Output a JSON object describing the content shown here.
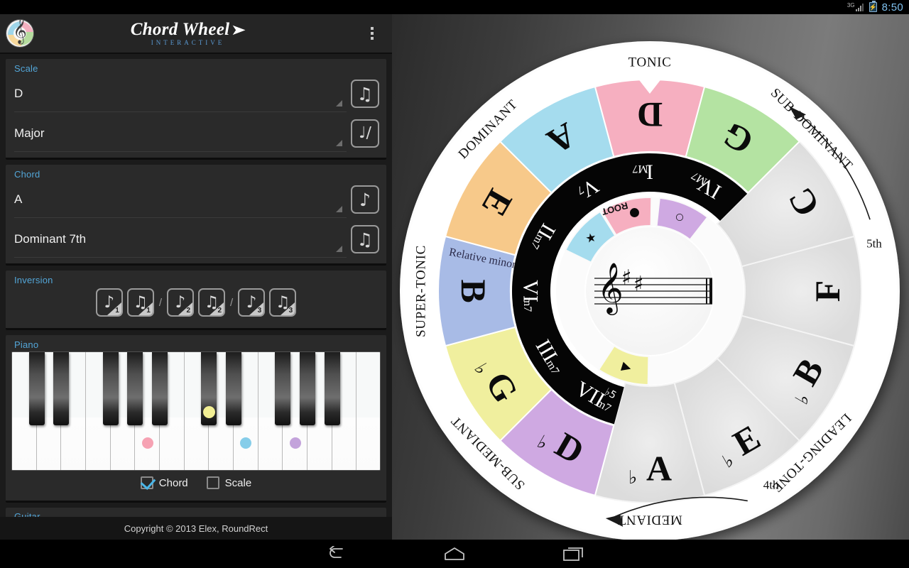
{
  "statusbar": {
    "network": "3G",
    "time": "8:50",
    "battery_icon": "battery-charging-icon"
  },
  "actionbar": {
    "logo_icon": "app-logo-treble-clef-icon",
    "title": "Chord Wheel",
    "wing_icon": "wing-icon",
    "subtitle": "INTERACTIVE",
    "overflow_icon": "overflow-menu-icon"
  },
  "scale_card": {
    "label": "Scale",
    "root": {
      "value": "D",
      "play_icon": "two-eighth-notes-icon"
    },
    "type": {
      "value": "Major",
      "play_icon": "scale-notes-icon"
    }
  },
  "chord_card": {
    "label": "Chord",
    "root": {
      "value": "A",
      "play_icon": "single-note-icon"
    },
    "type": {
      "value": "Dominant 7th",
      "play_icon": "chord-notes-icon"
    }
  },
  "inversion_card": {
    "label": "Inversion",
    "buttons": [
      {
        "icon": "single-note-icon",
        "number": "1"
      },
      {
        "icon": "chord-notes-icon",
        "number": "1"
      },
      {
        "icon": "single-note-icon",
        "number": "2"
      },
      {
        "icon": "chord-notes-icon",
        "number": "2"
      },
      {
        "icon": "single-note-icon",
        "number": "3"
      },
      {
        "icon": "chord-notes-icon",
        "number": "3"
      }
    ],
    "separators": [
      "/",
      "/"
    ]
  },
  "piano_card": {
    "label": "Piano",
    "white_key_count": 15,
    "black_key_count": 10,
    "markers": [
      {
        "note": "A",
        "color": "#f6a2b3",
        "key": "white",
        "index": 5
      },
      {
        "note": "C#",
        "color": "#f2ef94",
        "key": "black",
        "index": 5
      },
      {
        "note": "E",
        "color": "#86cde9",
        "key": "white",
        "index": 9
      },
      {
        "note": "G",
        "color": "#c3a3db",
        "key": "white",
        "index": 11
      }
    ],
    "chord_checkbox": {
      "label": "Chord",
      "checked": true
    },
    "scale_checkbox": {
      "label": "Scale",
      "checked": false
    }
  },
  "guitar_card": {
    "label": "Guitar"
  },
  "footer": {
    "copyright": "Copyright © 2013 Elex, RoundRect"
  },
  "navbar": {
    "back_icon": "back-arrow-icon",
    "home_icon": "home-icon",
    "recents_icon": "recent-apps-icon"
  },
  "wheel": {
    "function_labels": [
      {
        "text": "TONIC",
        "angle": 0
      },
      {
        "text": "SUB-DOMINANT",
        "angle": 45
      },
      {
        "text": "DOMINANT",
        "angle": -45
      },
      {
        "text": "SUPER-TONIC",
        "angle": -90
      },
      {
        "text": "SUB-MEDIANT",
        "angle": -135
      },
      {
        "text": "MEDIANT",
        "angle": 180
      },
      {
        "text": "LEADING-TONE",
        "angle": 135
      }
    ],
    "note_segments": [
      {
        "note": "D",
        "accidental": "",
        "color": "#f6afc0",
        "angle": 0,
        "active": true
      },
      {
        "note": "G",
        "accidental": "",
        "color": "#b4e3a2",
        "angle": 30,
        "active": true
      },
      {
        "note": "C",
        "accidental": "",
        "color": "#e9e9e9",
        "angle": 60,
        "active": false
      },
      {
        "note": "F",
        "accidental": "",
        "color": "#e9e9e9",
        "angle": 90,
        "active": false
      },
      {
        "note": "B",
        "accidental": "♭",
        "color": "#e9e9e9",
        "angle": 120,
        "active": false
      },
      {
        "note": "E",
        "accidental": "♭",
        "color": "#e9e9e9",
        "angle": 150,
        "active": false
      },
      {
        "note": "A",
        "accidental": "♭",
        "color": "#e9e9e9",
        "angle": 180,
        "active": false
      },
      {
        "note": "D",
        "accidental": "♭",
        "color": "#cfa9e2",
        "angle": 210,
        "active": true
      },
      {
        "note": "G",
        "accidental": "♭",
        "color": "#f0ef9e",
        "angle": 240,
        "active": true
      },
      {
        "note": "B",
        "accidental": "",
        "color": "#a8bbe6",
        "angle": 270,
        "active": true
      },
      {
        "note": "E",
        "accidental": "",
        "color": "#f7c98a",
        "angle": 300,
        "active": true
      },
      {
        "note": "A",
        "accidental": "",
        "color": "#a5dcee",
        "angle": 330,
        "active": true
      }
    ],
    "relative_minor_label": "Relative minor",
    "roman_numerals": [
      {
        "numeral": "I",
        "quality": "M7",
        "angle": 0
      },
      {
        "numeral": "IV",
        "quality": "M7",
        "angle": 30
      },
      {
        "numeral": "VII",
        "quality": "m7",
        "flat5": "♭5",
        "angle": 210
      },
      {
        "numeral": "III",
        "quality": "m7",
        "angle": 240
      },
      {
        "numeral": "VI",
        "quality": "m7",
        "angle": 270
      },
      {
        "numeral": "II",
        "quality": "m7",
        "angle": 300
      },
      {
        "numeral": "V",
        "quality": "7",
        "angle": 330
      }
    ],
    "chord_tone_segments": [
      {
        "label": "ROOT",
        "glyph": "●",
        "color": "#f6afc0",
        "angle": -15
      },
      {
        "glyph": "○",
        "color": "#cfa9e2",
        "angle": 22
      },
      {
        "glyph": "★",
        "color": "#a5dcee",
        "angle": -48
      },
      {
        "glyph": "▶",
        "color": "#f0ef9e",
        "angle": 197
      }
    ],
    "staff": {
      "clef": "treble-clef-icon",
      "key_signature": "2 sharps",
      "sharps": 2,
      "barline": "double-barline"
    },
    "pointer_icon": "tonic-pointer-icon",
    "direction_labels": [
      {
        "text": "5th",
        "arrow": "up-arrow-clockwise"
      },
      {
        "text": "4th",
        "arrow": "down-arrow-counterclockwise"
      }
    ]
  }
}
